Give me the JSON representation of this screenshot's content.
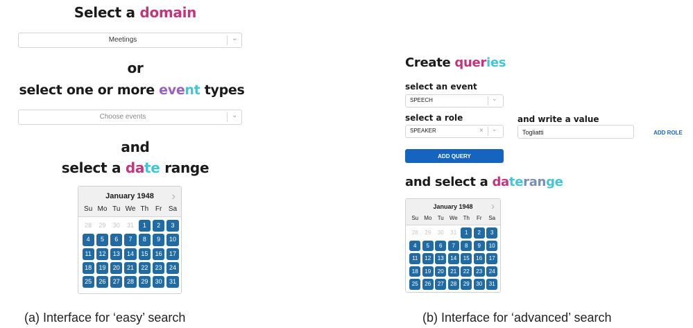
{
  "easy": {
    "title": {
      "pre": "Select a ",
      "hl": "domain"
    },
    "domain_select": {
      "value": "Meetings"
    },
    "or": "or",
    "event_title": {
      "pre": "select one or more ",
      "hl1": "eve",
      "hl2": "nt",
      "post": " types"
    },
    "events_select": {
      "placeholder": "Choose events"
    },
    "and": "and",
    "date_title": {
      "pre": "select a ",
      "hl1": "da",
      "hl2": "te",
      "post": " range"
    },
    "caption": "(a) Interface for ‘easy’ search"
  },
  "advanced": {
    "title": {
      "pre": "Create ",
      "hl1": "quer",
      "hl2": "ies"
    },
    "event_label": "select an event",
    "event_select": {
      "value": "SPEECH"
    },
    "role_label": "select a role",
    "role_select": {
      "value": "SPEAKER",
      "clear": "×"
    },
    "value_label": "and write a value",
    "value_input": {
      "value": "Togliatti"
    },
    "add_role_label": "ADD ROLE",
    "add_query_label": "ADD QUERY",
    "date_title": {
      "pre": "and select a ",
      "hl1": "da",
      "hl2": "te",
      "hl3": "ran",
      "hl4": "ge"
    },
    "caption": "(b) Interface for ‘advanced’ search"
  },
  "calendar": {
    "month": "January 1948",
    "weekdays": [
      "Su",
      "Mo",
      "Tu",
      "We",
      "Th",
      "Fr",
      "Sa"
    ],
    "leading_days": [
      "28",
      "29",
      "30",
      "31"
    ],
    "days": [
      "1",
      "2",
      "3",
      "4",
      "5",
      "6",
      "7",
      "8",
      "9",
      "10",
      "11",
      "12",
      "13",
      "14",
      "15",
      "16",
      "17",
      "18",
      "19",
      "20",
      "21",
      "22",
      "23",
      "24",
      "25",
      "26",
      "27",
      "28",
      "29",
      "30",
      "31"
    ],
    "first_weekday_index": 4
  },
  "icons": {
    "chevron": "chevron-down-icon",
    "next": "chevron-right-icon",
    "clear": "clear-icon"
  },
  "colors": {
    "pink": "#c2357f",
    "cyan": "#42c5d4",
    "violet": "#9a5fbf",
    "calendar_day": "#216ba5",
    "button": "#1565c0"
  }
}
